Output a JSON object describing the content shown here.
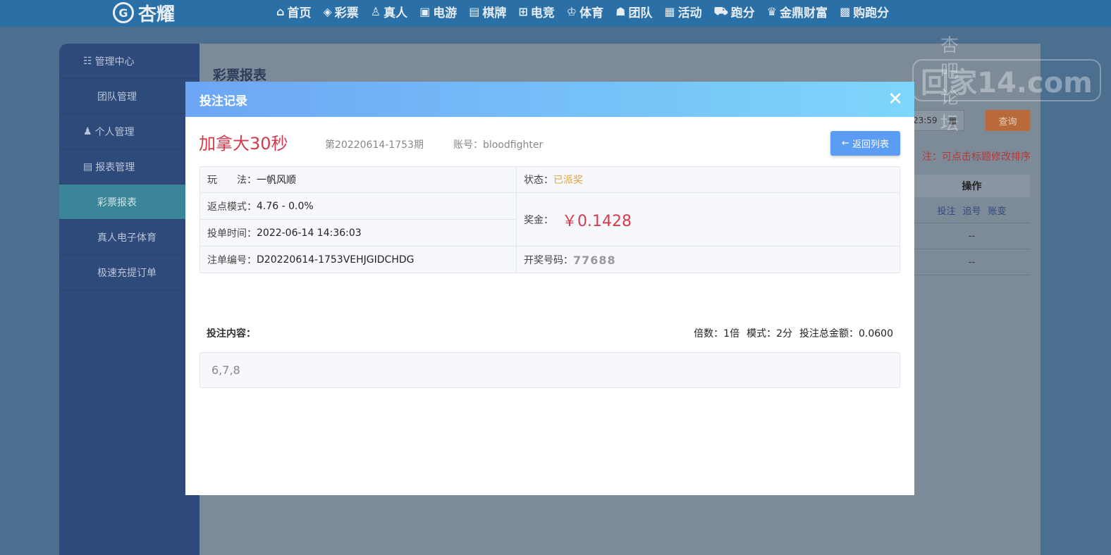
{
  "header": {
    "logo_text": "杏耀",
    "nav": [
      {
        "icon": "home-icon",
        "glyph": "⌂",
        "label": "首页"
      },
      {
        "icon": "lottery-icon",
        "glyph": "◈",
        "label": "彩票"
      },
      {
        "icon": "live-icon",
        "glyph": "♙",
        "label": "真人"
      },
      {
        "icon": "slots-icon",
        "glyph": "▣",
        "label": "电游"
      },
      {
        "icon": "cards-icon",
        "glyph": "▤",
        "label": "棋牌"
      },
      {
        "icon": "gamepad-icon",
        "glyph": "⊞",
        "label": "电竞"
      },
      {
        "icon": "trophy-icon",
        "glyph": "♔",
        "label": "体育"
      },
      {
        "icon": "team-icon",
        "glyph": "☗",
        "label": "团队"
      },
      {
        "icon": "gift-icon",
        "glyph": "▦",
        "label": "活动"
      },
      {
        "icon": "car-icon",
        "glyph": "⛟",
        "label": "跑分"
      },
      {
        "icon": "wealth-icon",
        "glyph": "♛",
        "label": "金鼎财富"
      },
      {
        "icon": "points-icon",
        "glyph": "▩",
        "label": "购跑分"
      }
    ]
  },
  "sidebar": {
    "items": [
      {
        "type": "group",
        "label": "管理中心"
      },
      {
        "type": "sub",
        "label": "团队管理"
      },
      {
        "type": "group",
        "label": "个人管理"
      },
      {
        "type": "group",
        "label": "报表管理"
      },
      {
        "type": "sub",
        "label": "彩票报表",
        "active": true
      },
      {
        "type": "sub",
        "label": "真人电子体育"
      },
      {
        "type": "sub",
        "label": "极速充提订单"
      }
    ]
  },
  "page": {
    "title": "彩票报表",
    "date_partial": "23:59",
    "query_button": "查询",
    "note": "注：可点击标题修改排序",
    "op_header": "操作",
    "op_row1": [
      "投注",
      "追号",
      "账变"
    ],
    "op_row2": "--",
    "op_row3": "--"
  },
  "watermark": {
    "line1": "杏吧论坛",
    "line2": "回家14.com"
  },
  "modal": {
    "title": "投注记录",
    "close_glyph": "✕",
    "lottery_name": "加拿大30秒",
    "issue": "第20220614-1753期",
    "account_label": "账号：",
    "account_value": "bloodfighter",
    "back_button": "返回列表",
    "details": {
      "play_label": "玩　　法：",
      "play_value": "一帆风顺",
      "status_label": "状态：",
      "status_value": "已派奖",
      "rebate_label": "返点模式：",
      "rebate_value": "4.76 - 0.0%",
      "time_label": "投单时间：",
      "time_value": "2022-06-14 14:36:03",
      "prize_label": "奖金：",
      "prize_value": "￥0.1428",
      "order_label": "注单编号：",
      "order_value": "D20220614-1753VEHJGIDCHDG",
      "draw_label": "开奖号码：",
      "draw_value": "77688"
    },
    "content_label": "投注内容：",
    "multiplier": "倍数：1倍",
    "mode": "模式：2分",
    "total": "投注总金额：0.0600",
    "content_value": "6,7,8"
  },
  "colors": {
    "accent_red": "#d23b4e",
    "status_orange": "#e6a23c",
    "header_gradient_start": "#6ca6f5",
    "header_gradient_end": "#7ed6fa",
    "button_blue": "#5b9df5"
  }
}
